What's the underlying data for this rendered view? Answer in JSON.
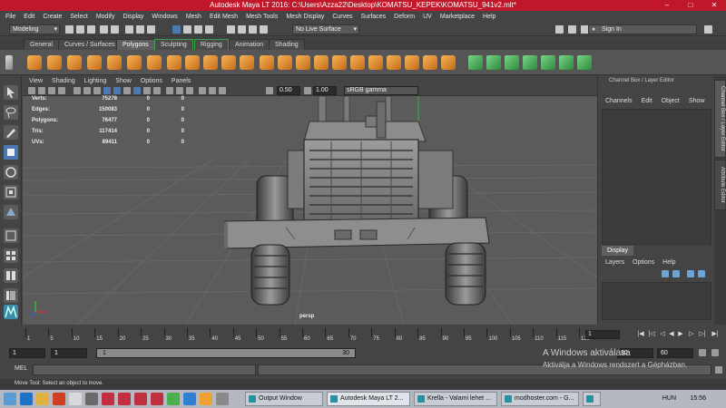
{
  "window": {
    "title": "Autodesk Maya LT 2016: C:\\Users\\Azza22\\Desktop\\KOMATSU_KEPEK\\KOMATSU_941v2.mlt*",
    "controls": [
      "–",
      "□",
      "✕"
    ]
  },
  "menubar": [
    "File",
    "Edit",
    "Create",
    "Select",
    "Modify",
    "Display",
    "Windows",
    "Mesh",
    "Edit Mesh",
    "Mesh Tools",
    "Mesh Display",
    "Curves",
    "Surfaces",
    "Deform",
    "UV",
    "Marketplace",
    "Help"
  ],
  "statusline": {
    "mode": "Modeling",
    "live_surface": "No Live Surface",
    "signin": "Sign In"
  },
  "shelf_tabs": [
    "General",
    "Curves / Surfaces",
    "Polygons",
    "Sculpting",
    "Rigging",
    "Animation",
    "Shading"
  ],
  "shelf_active_tab": "Polygons",
  "viewport": {
    "menu": [
      "View",
      "Shading",
      "Lighting",
      "Show",
      "Options",
      "Panels"
    ],
    "field_a": "0.50",
    "field_b": "1.00",
    "colorspace": "sRGB gamma",
    "camera": "persp",
    "hud": [
      {
        "label": "Verts:",
        "v1": "75278",
        "v2": "0",
        "v3": "0"
      },
      {
        "label": "Edges:",
        "v1": "150083",
        "v2": "0",
        "v3": "0"
      },
      {
        "label": "Polygons:",
        "v1": "76477",
        "v2": "0",
        "v3": "0"
      },
      {
        "label": "Tris:",
        "v1": "117414",
        "v2": "0",
        "v3": "0"
      },
      {
        "label": "UVs:",
        "v1": "89411",
        "v2": "0",
        "v3": "0"
      }
    ]
  },
  "right_panel": {
    "title": "Channel Box / Layer Editor",
    "menu": [
      "Channels",
      "Edit",
      "Object",
      "Show"
    ],
    "display_tab": "Display",
    "layer_menu": [
      "Layers",
      "Options",
      "Help"
    ],
    "side_tabs": [
      "Channel Box / Layer Editor",
      "Attribute Editor"
    ]
  },
  "timeslider": {
    "tick_labels": [
      "1",
      "5",
      "10",
      "15",
      "20",
      "25",
      "30",
      "35",
      "40",
      "45",
      "50",
      "55",
      "60",
      "65",
      "70",
      "75",
      "80",
      "85",
      "90",
      "95",
      "100",
      "105",
      "110",
      "115",
      "120"
    ],
    "current_frame": "1"
  },
  "rangeslider": {
    "start": "1",
    "start2": "1",
    "bar_left": "1",
    "bar_right": "30",
    "end": "30",
    "end2": "60"
  },
  "cmdline": {
    "label": "MEL"
  },
  "helpline": "Move Tool: Select an object to move.",
  "watermark": {
    "line1": "A Windows aktiválása",
    "line2": "Aktiválja a Windows rendszert a Gépházban."
  },
  "taskbar": {
    "buttons": [
      "Output Window",
      "Autodesk Maya LT 2...",
      "Krella - Valami lehet ...",
      "modhoster.com - G...",
      ""
    ],
    "lang": "HUN",
    "time": "15:56"
  }
}
